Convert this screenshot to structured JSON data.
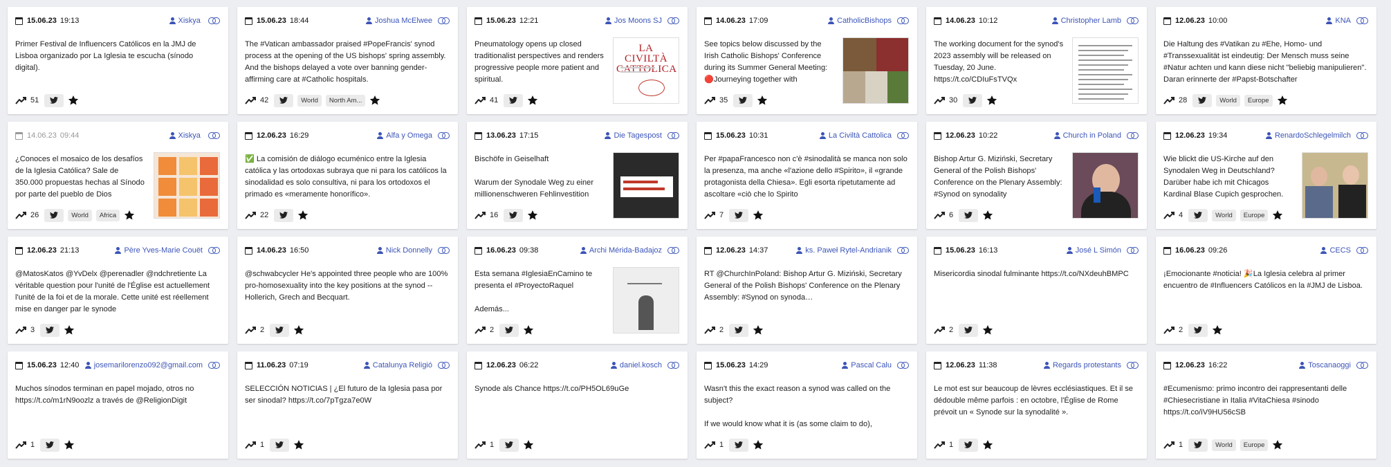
{
  "colors": {
    "accent": "#3c55b8",
    "background": "#edeef2",
    "card": "#ffffff"
  },
  "icons": {
    "date": "calendar-icon",
    "author": "person-icon",
    "link": "link-icon",
    "trend": "trending-up-icon",
    "share": "twitter-icon",
    "favorite": "star-icon"
  },
  "posts": [
    {
      "date": "15.06.23",
      "time": "19:13",
      "author": "Xiskya ‬",
      "text": "Primer Festival de Influencers Católicos en la JMJ de Lisboa organizado por La Iglesia te escucha (sínodo digital).",
      "count": "51",
      "tags": [],
      "thumb": null
    },
    {
      "date": "15.06.23",
      "time": "18:44",
      "author": "Joshua McElwee",
      "text": "The #Vatican ambassador praised #PopeFrancis' synod process at the opening of the US bishops' spring assembly. And the bishops delayed a vote over banning gender-affirming care at #Catholic hospitals.",
      "count": "42",
      "tags": [
        "World",
        "North Am..."
      ],
      "thumb": null
    },
    {
      "date": "15.06.23",
      "time": "12:21",
      "author": "Jos Moons SJ",
      "text": "Pneumatology opens up closed traditionalist perspectives and renders progressive people more patient and spiritual.",
      "count": "41",
      "tags": [],
      "thumb": "civilta"
    },
    {
      "date": "14.06.23",
      "time": "17:09",
      "author": "CatholicBishops",
      "text": "See topics below discussed by the Irish Catholic Bishops' Conference during its Summer General Meeting:\n🔴Journeying together with",
      "count": "35",
      "tags": [],
      "thumb": "collage"
    },
    {
      "date": "14.06.23",
      "time": "10:12",
      "author": "Christopher Lamb",
      "text": "The working document for the synod's 2023 assembly will be released on Tuesday, 20 June. https://t.co/CDIuFsTVQx",
      "count": "30",
      "tags": [],
      "thumb": "doc"
    },
    {
      "date": "12.06.23",
      "time": "10:00",
      "author": "KNA",
      "text": "Die Haltung des #Vatikan zu #Ehe, Homo- und #Transsexualität ist eindeutig: Der Mensch muss seine #Natur achten und kann diese nicht \"beliebig manipulieren\". Daran erinnerte der #Papst-Botschafter",
      "count": "28",
      "tags": [
        "World",
        "Europe"
      ],
      "thumb": null
    },
    {
      "date": "14.06.23",
      "time": "09:44",
      "author": "Xiskya ‬",
      "text": "¿Conoces el mosaico de los desafíos de la Iglesia Católica? Sale de 350.000 propuestas hechas al Sínodo por parte del pueblo de Dios",
      "count": "26",
      "tags": [
        "World",
        "Africa"
      ],
      "thumb": "mosaic",
      "muted": true
    },
    {
      "date": "12.06.23",
      "time": "16:29",
      "author": "Alfa y Omega",
      "text": "✅ La comisión de diálogo ecuménico entre la Iglesia católica y las ortodoxas subraya que ni para los católicos la sinodalidad es solo consultiva, ni para los ortodoxos el primado es «meramente honorífico».",
      "count": "22",
      "tags": [],
      "thumb": null
    },
    {
      "date": "13.06.23",
      "time": "17:15",
      "author": "Die Tagespost",
      "text": "Bischöfe in Geiselhaft\n\nWarum der Synodale Weg zu einer millionenschweren Fehlinvestition",
      "count": "16",
      "tags": [],
      "thumb": "banner"
    },
    {
      "date": "15.06.23",
      "time": "10:31",
      "author": "La Civiltà Cattolica",
      "text": "Per #papaFrancesco non c'è #sinodalità se manca non solo la presenza, ma anche «l'azione dello #Spirito», il «grande protagonista della Chiesa». Egli esorta ripetutamente ad ascoltare «ciò che lo Spirito",
      "count": "7",
      "tags": [],
      "thumb": null
    },
    {
      "date": "12.06.23",
      "time": "10:22",
      "author": "Church in Poland",
      "text": "Bishop Artur G. Miziński, Secretary General of the Polish Bishops' Conference on the Plenary Assembly: #Synod on synodality",
      "count": "6",
      "tags": [],
      "thumb": "bishop"
    },
    {
      "date": "12.06.23",
      "time": "19:34",
      "author": "RenardoSchlegelmilch",
      "text": "Wie blickt die US-Kirche auf den Synodalen Weg in Deutschland? Darüber habe ich mit Chicagos Kardinal Blase Cupich gesprochen.",
      "count": "4",
      "tags": [
        "World",
        "Europe"
      ],
      "thumb": "two"
    },
    {
      "date": "12.06.23",
      "time": "21:13",
      "author": "Père Yves-Marie Couët",
      "text": "@MatosKatos @YvDelx @perenadler @ndchretiente La véritable question pour l'unité de l'Église est actuellement l'unité de la foi et de la morale. Cette unité est réellement mise en danger par le synode",
      "count": "3",
      "tags": [],
      "thumb": null
    },
    {
      "date": "14.06.23",
      "time": "16:50",
      "author": "Nick Donnelly",
      "text": "@schwabcycler He's appointed three people who are 100% pro-homosexuality into the key positions at the synod -- Hollerich, Grech and Becquart.",
      "count": "2",
      "tags": [],
      "thumb": null
    },
    {
      "date": "16.06.23",
      "time": "09:38",
      "author": "Archi Mérida-Badajoz",
      "text": "Esta semana #IglesiaEnCamino te presenta el #ProyectoRaquel\n\nAdemás...",
      "count": "2",
      "tags": [],
      "thumb": "poster"
    },
    {
      "date": "12.06.23",
      "time": "14:37",
      "author": "ks. Paweł Rytel-Andrianik",
      "text": "RT @ChurchInPoland: Bishop Artur G. Miziński, Secretary General of the Polish Bishops' Conference on the Plenary Assembly: #Synod on synoda…",
      "count": "2",
      "tags": [],
      "thumb": null
    },
    {
      "date": "15.06.23",
      "time": "16:13",
      "author": "José L Simón",
      "text": "Misericordia sinodal fulminante https://t.co/NXdeuhBMPC",
      "count": "2",
      "tags": [],
      "thumb": null
    },
    {
      "date": "16.06.23",
      "time": "09:26",
      "author": "CECS",
      "text": "¡Emocionante #noticia! 🎉La Iglesia celebra al primer encuentro de #Influencers Católicos en la #JMJ de Lisboa.",
      "count": "2",
      "tags": [],
      "thumb": null
    },
    {
      "date": "15.06.23",
      "time": "12:40",
      "author": "josemarilorenzo092@gmail.com",
      "text": "Muchos sínodos terminan en papel mojado, otros no https://t.co/m1rN9oozlz a través de @ReligionDigit",
      "count": "1",
      "tags": [],
      "thumb": null
    },
    {
      "date": "11.06.23",
      "time": "07:19",
      "author": "Catalunya Religió",
      "text": "SELECCIÓN NOTICIAS | ¿El futuro de la Iglesia pasa por ser sinodal? https://t.co/7pTgza7e0W",
      "count": "1",
      "tags": [],
      "thumb": null
    },
    {
      "date": "12.06.23",
      "time": "06:22",
      "author": "daniel.kosch",
      "text": "Synode als Chance https://t.co/PH5OL69uGe",
      "count": "1",
      "tags": [],
      "thumb": null
    },
    {
      "date": "15.06.23",
      "time": "14:29",
      "author": "Pascal Calu",
      "text": "Wasn't this the exact reason a synod was called on the subject?\n\nIf we would know what it is (as some claim to do),",
      "count": "1",
      "tags": [],
      "thumb": null
    },
    {
      "date": "12.06.23",
      "time": "11:38",
      "author": "Regards protestants",
      "text": "Le mot est sur beaucoup de lèvres ecclésiastiques. Et il se dédouble même parfois : en octobre, l'Église de Rome prévoit un « Synode sur la synodalité ».",
      "count": "1",
      "tags": [],
      "thumb": null
    },
    {
      "date": "12.06.23",
      "time": "16:22",
      "author": "Toscanaoggi",
      "text": "#Ecumenismo: primo incontro dei rappresentanti delle #Chiesecristiane in Italia #VitaChiesa #sinodo https://t.co/iV9HU56cSB",
      "count": "1",
      "tags": [
        "World",
        "Europe"
      ],
      "thumb": null
    }
  ]
}
